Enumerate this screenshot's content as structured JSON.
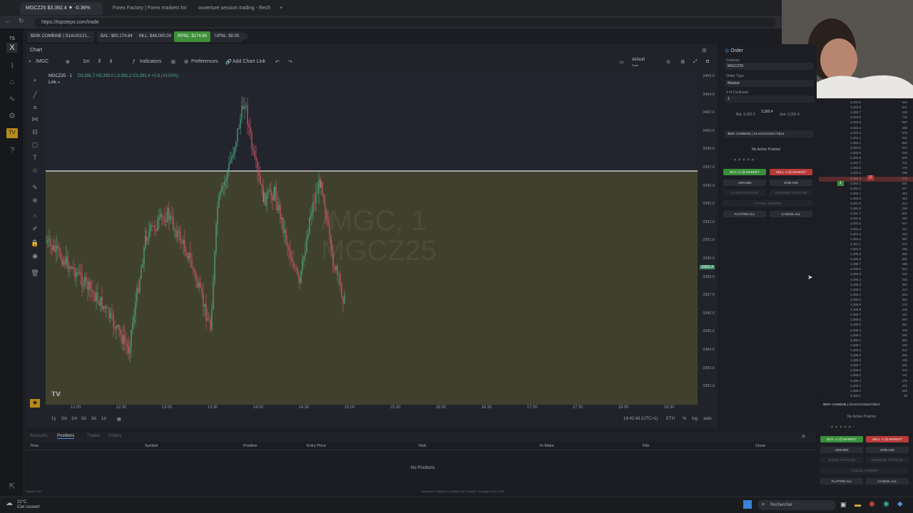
{
  "browser": {
    "tabs": [
      {
        "label": "MGCZ25 $3,392.4 ▼ -0.36%",
        "active": true
      },
      {
        "label": "Forex Factory | Forex markets for",
        "active": false
      },
      {
        "label": "ouverture session trading - Rech",
        "active": false
      }
    ],
    "url": "https://topstepx.com/trade"
  },
  "account_bar": {
    "account": "$50K COMBINE | S1AUG121...",
    "bal": "BAL: $50,174.84",
    "mll": "MLL: $48,000.00",
    "rpnl": "RPNL: $174.84",
    "upnl": "UPNL: $0.00"
  },
  "chart": {
    "panel_label": "Chart",
    "symbol_search": "/MGC",
    "timeframe": "1m",
    "indicators_label": "Indicators",
    "preferences_label": "Preferences",
    "add_chart_link_label": "Add Chart Link",
    "layout_name": "default",
    "layout_sub": "Save",
    "legend_symbol": "MGCZ25 · 1",
    "legend_ohlc": "O3,391.7 H3,393.0 L3,391.2 C3,392.4 +0.8 (+0.02%)",
    "link_label": "Link",
    "watermark_line1": "/MGC, 1",
    "watermark_line2": "MGCZ25",
    "current_price_tag": "3392.4",
    "price_ticks": [
      "3406.0",
      "3404.0",
      "3402.0",
      "3400.0",
      "3399.0",
      "3397.0",
      "3396.0",
      "3395.0",
      "3393.0",
      "3391.0",
      "3390.0",
      "3389.0",
      "3387.0",
      "3386.0",
      "3385.0",
      "3384.0",
      "3383.0",
      "3382.0"
    ],
    "time_ticks": [
      "12:00",
      "12:30",
      "13:00",
      "13:30",
      "14:00",
      "14:30",
      "15:00",
      "15:30",
      "16:00",
      "16:30",
      "17:00",
      "17:30",
      "18:00",
      "18:30"
    ],
    "ranges": [
      "1y",
      "3m",
      "1m",
      "5d",
      "3d",
      "1d"
    ],
    "clock": "14:42:48 (UTC+1)",
    "session": "ETH",
    "scale_pct": "%",
    "scale_log": "log",
    "scale_auto": "auto",
    "colors": {
      "up": "#4fae86",
      "down": "#d9556a",
      "overlay": "#5a5a2e",
      "level": "#e8e8e8"
    }
  },
  "order": {
    "title": "Order",
    "contract_label": "Contract",
    "contract_value": "MGCZ25",
    "order_type_label": "Order Type",
    "order_type_value": "Market",
    "contracts_label": "# of Contracts",
    "contracts_value": "1",
    "bid": "Bid: 3,392.3",
    "last": "3,392.4",
    "ask": "Ask: 3,392.4",
    "account": "$50K COMBINE | S1AUG12154172514",
    "no_position": "No Active Position",
    "buy_market": "BUY +1 @ MARKET",
    "sell_market": "SELL -1 @ MARKET",
    "join_bid": "JOIN BID",
    "join_ask": "JOIN ASK",
    "close_position": "CLOSE POSITION",
    "reverse_position": "REVERSE POSITION",
    "cancel_orders": "CANCEL ORDERS",
    "flatten_all": "FLATTEN ALL",
    "cancel_all": "CANCEL ALL"
  },
  "ladder": {
    "prices": [
      "3,393.9",
      "3,393.8",
      "3,393.7",
      "3,393.6",
      "3,393.5",
      "3,393.4",
      "3,393.3",
      "3,393.2",
      "3,393.1",
      "3,393.0",
      "3,392.9",
      "3,392.8",
      "3,392.7",
      "3,392.6",
      "3,392.5",
      "3,392.4",
      "3,392.3",
      "3,392.2",
      "3,392.1",
      "3,392.0",
      "3,391.9",
      "3,391.8",
      "3,391.7",
      "3,391.6",
      "3,391.5",
      "3,391.4",
      "3,391.3",
      "3,391.2",
      "3,391.1",
      "3,391.0",
      "3,390.9",
      "3,390.8",
      "3,390.7",
      "3,390.6",
      "3,390.5",
      "3,390.4",
      "3,390.3",
      "3,390.2",
      "3,390.1",
      "3,390.0",
      "3,389.9",
      "3,389.8",
      "3,389.7",
      "3,389.6",
      "3,389.5",
      "3,389.4",
      "3,389.3",
      "3,389.2",
      "3,389.1",
      "3,389.0",
      "3,388.9",
      "3,388.8",
      "3,388.7",
      "3,388.6",
      "3,388.5",
      "3,388.4",
      "3,388.3",
      "3,388.2",
      "3,388.1"
    ],
    "volumes": [
      "544",
      "521",
      "338",
      "740",
      "587",
      "388",
      "578",
      "511",
      "884",
      "612",
      "320",
      "505",
      "412",
      "475",
      "296",
      "473",
      "531",
      "417",
      "482",
      "463",
      "312",
      "398",
      "601",
      "482",
      "547",
      "411",
      "434",
      "367",
      "612",
      "446",
      "458",
      "391",
      "288",
      "564",
      "312",
      "348",
      "384",
      "417",
      "404",
      "482",
      "273",
      "429",
      "341",
      "367",
      "351",
      "428",
      "292",
      "362",
      "425",
      "314",
      "356",
      "345",
      "391",
      "423",
      "411",
      "375",
      "322",
      "358",
      "98"
    ],
    "bid_marker": "1",
    "ask_marker": "2"
  },
  "bottom_order": {
    "account": "$50K COMBINE | S1AUG12154172514",
    "no_position": "No Active Position"
  },
  "positions": {
    "tabs": [
      "Accounts",
      "Positions",
      "Trades",
      "Orders"
    ],
    "active_tab": "Positions",
    "columns": [
      "Time",
      "Symbol",
      "Position",
      "Entry Price",
      "Risk",
      "To Make",
      "P&L",
      "Close"
    ],
    "empty": "No Positions",
    "license": "Licensed to Topstep & powered by ProjectX. Copyright 2024-2025",
    "version": "Version 1.0.0"
  },
  "taskbar": {
    "temp": "22°C",
    "weather": "Ciel couvert",
    "search": "Rechercher"
  }
}
